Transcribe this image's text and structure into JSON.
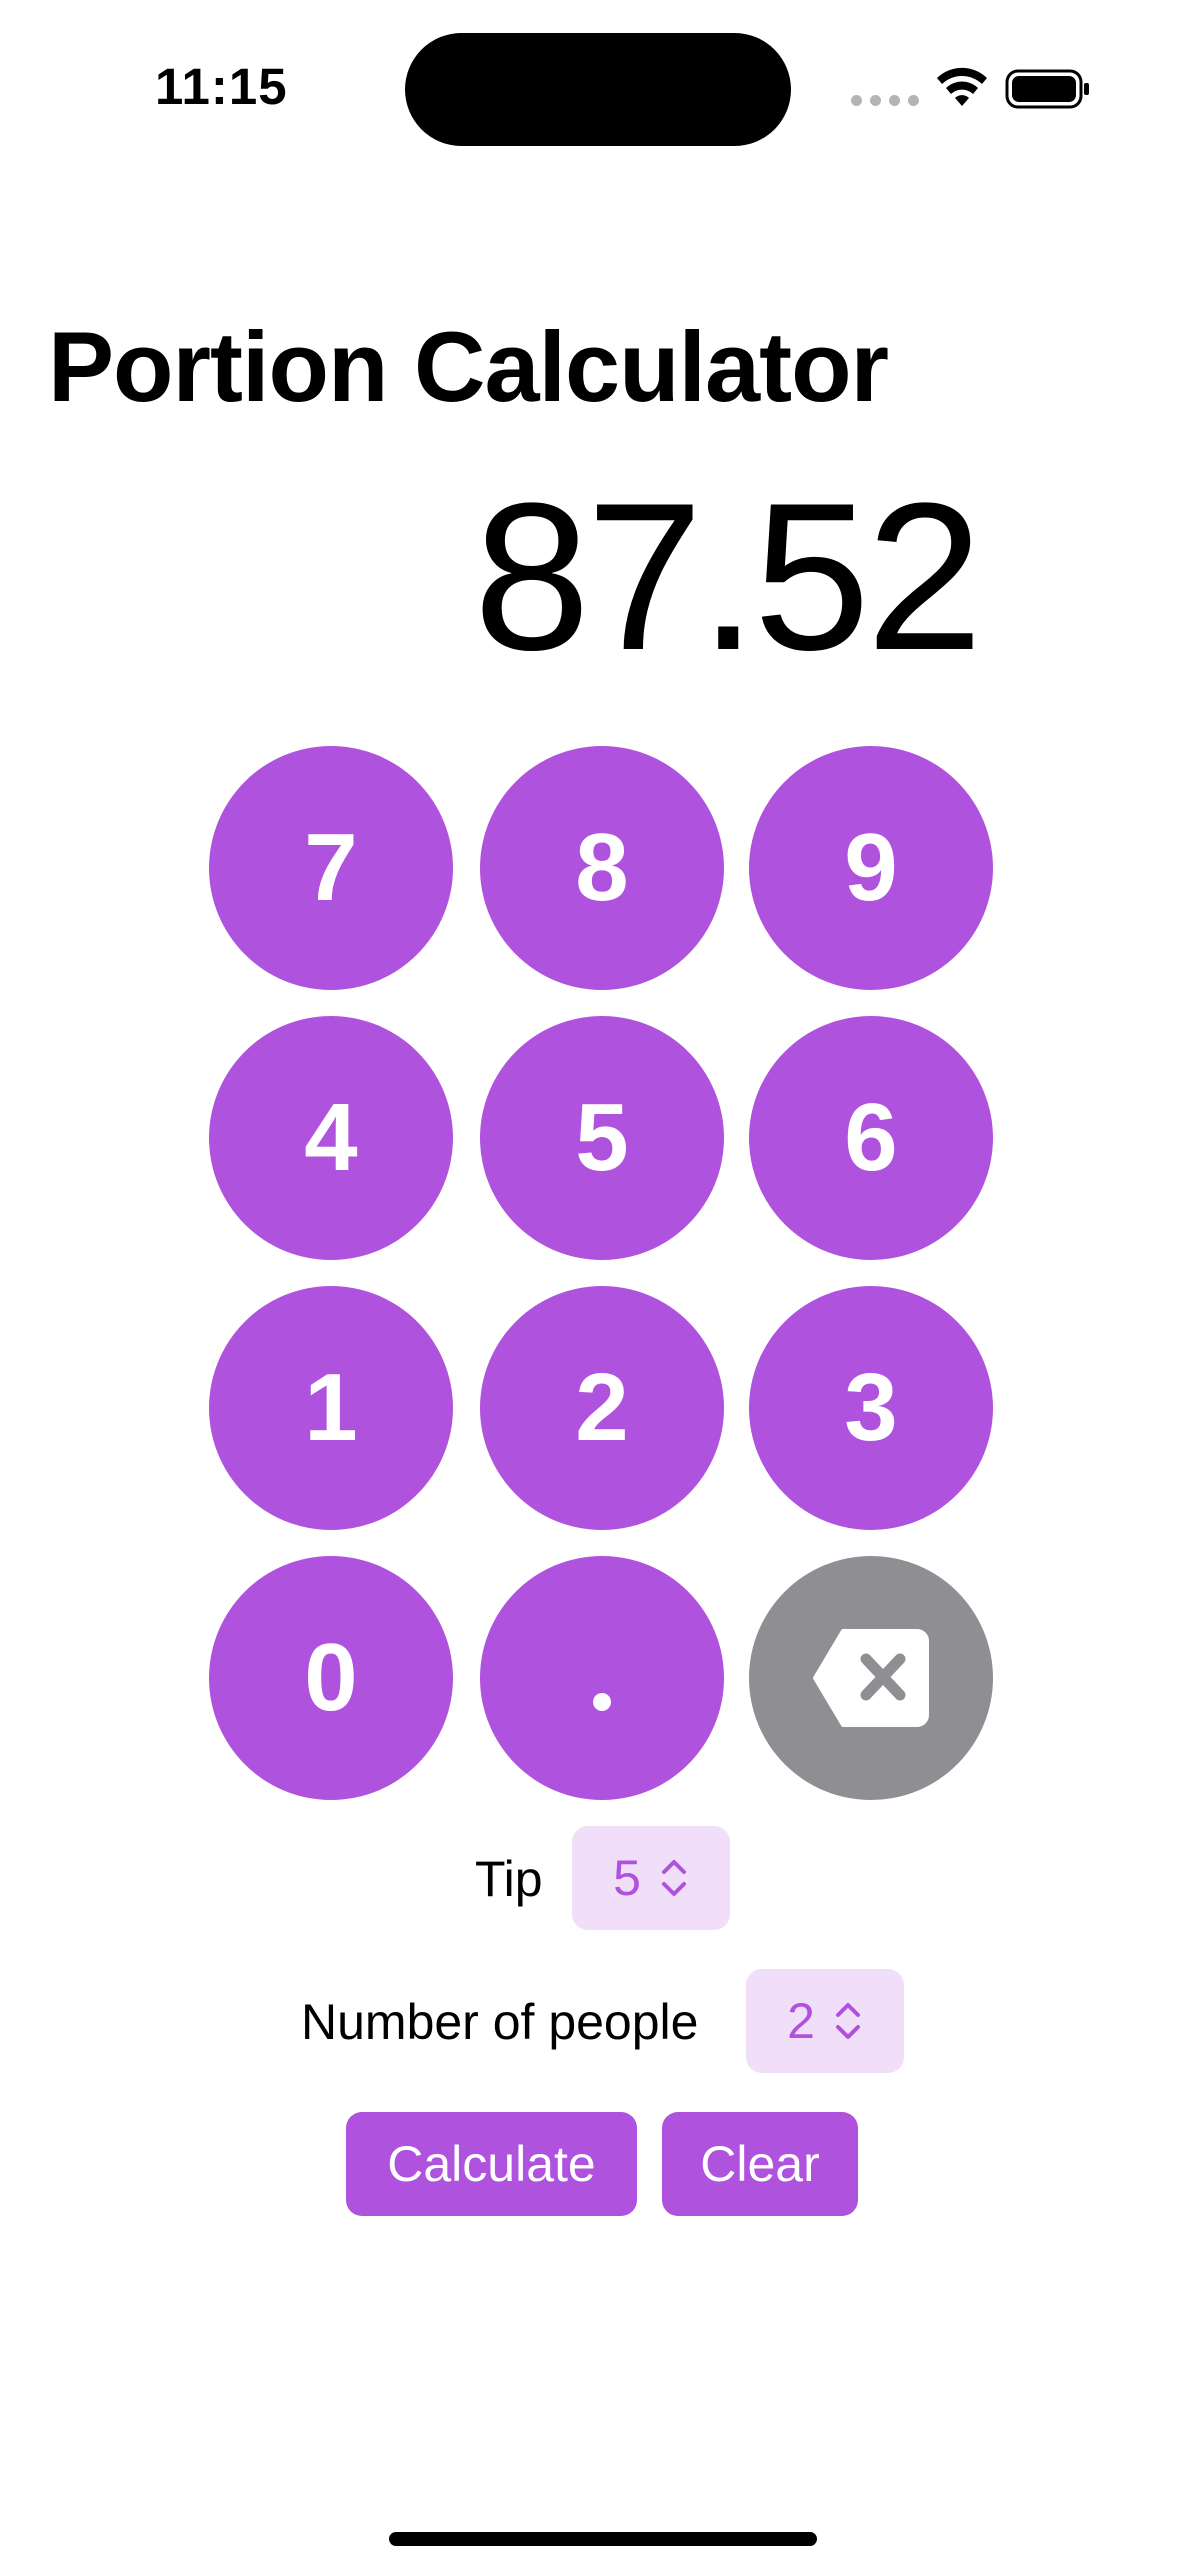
{
  "status_bar": {
    "time": "11:15"
  },
  "title": "Portion Calculator",
  "display": {
    "value": "87.52"
  },
  "keypad": {
    "keys": [
      "7",
      "8",
      "9",
      "4",
      "5",
      "6",
      "1",
      "2",
      "3",
      "0",
      "."
    ],
    "backspace_icon": "delete-backward-icon"
  },
  "tip": {
    "label": "Tip",
    "value": "5"
  },
  "people": {
    "label": "Number of people",
    "value": "2"
  },
  "actions": {
    "calculate_label": "Calculate",
    "clear_label": "Clear"
  },
  "colors": {
    "accent": "#af52de",
    "accent_light": "#f1def9",
    "backspace": "#8e8e93"
  }
}
